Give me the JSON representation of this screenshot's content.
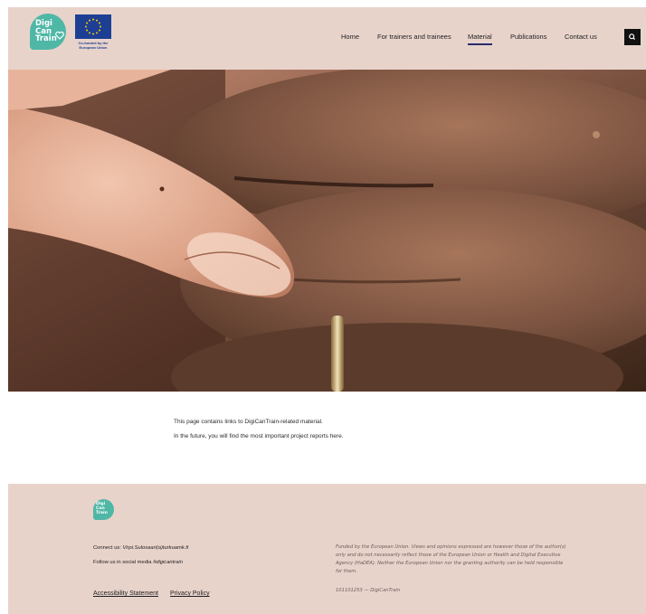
{
  "header": {
    "logo_text": [
      "Digi",
      "Can",
      "Train"
    ],
    "eu_caption": "Co-funded by the European Union",
    "nav": [
      {
        "label": "Home",
        "active": false
      },
      {
        "label": "For trainers and trainees",
        "active": false
      },
      {
        "label": "Material",
        "active": true
      },
      {
        "label": "Publications",
        "active": false
      },
      {
        "label": "Contact us",
        "active": false
      }
    ],
    "search_icon": "search-icon"
  },
  "content": {
    "line1": "This page contains links to DigiCanTrain-related material.",
    "line2": "In the future, you will find the most important project reports here."
  },
  "footer": {
    "logo_text": [
      "Digi",
      "Can",
      "Train"
    ],
    "connect_label": "Connect us: ",
    "connect_email": "Virpi.Sulosaari(a)turkuamk.fi",
    "follow_label": "Follow us in social media ",
    "follow_tag": "#digicantrain",
    "links": [
      "Accessibility Statement",
      "Privacy Policy"
    ],
    "disclaimer": "Funded by the European Union. Views and opinions expressed are however those of the author(s) only and do not necessarily reflect those of the European Union or Health and Digital Executive Agency (HaDEA). Neither the European Union nor the granting authority can be held responsible for them.",
    "grant": "101101253 — DigiCanTrain"
  },
  "colors": {
    "header_bg": "#e8d3cb",
    "logo_teal": "#4fb7a6",
    "eu_blue": "#1c3f94",
    "eu_stars": "#ffcc00",
    "nav_underline": "#2b2b6b"
  }
}
